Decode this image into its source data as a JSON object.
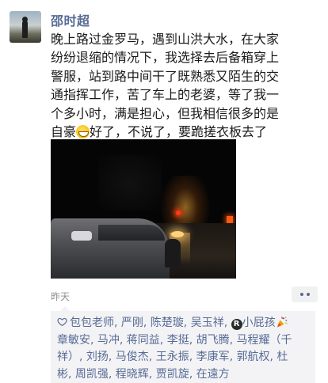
{
  "post": {
    "author": "邵时超",
    "text_lines": [
      "晚上路过金罗马，遇到山洪大水，在大家",
      "纷纷退缩的情况下，我选择去后备箱穿上",
      "警服，站到路中间干了既熟悉又陌生的交",
      "通指挥工作，苦了车上的老婆，等了我一",
      "个多小时，满是担心，但我相信很多的是"
    ],
    "text_last_before_emoji": "自豪",
    "emoji": "grin-emoji",
    "text_last_after_emoji": "好了，不说了，要跪搓衣板去了",
    "time": "昨天"
  },
  "likes": {
    "icon": "heart-icon",
    "line1_a": "包包老师, 严刚, 陈楚璇, 吴玉祥, ",
    "reg_symbol": "R",
    "line1_b": "小屁孩",
    "line2": "章敏安, 马冲, 蒋同益, 李挺, 胡飞腾, 马程耀（千",
    "line3": "祥）, 刘扬, 马俊杰, 王永振, 李康军, 郭航权, 杜",
    "line4": "彬, 周凯强, 程晓辉, 贾凯旋, 在遠方"
  },
  "colors": {
    "name_link": "#576b95",
    "text": "#1a1a1a",
    "time": "#8f8f8f",
    "likes_bg": "#f3f3f5"
  }
}
